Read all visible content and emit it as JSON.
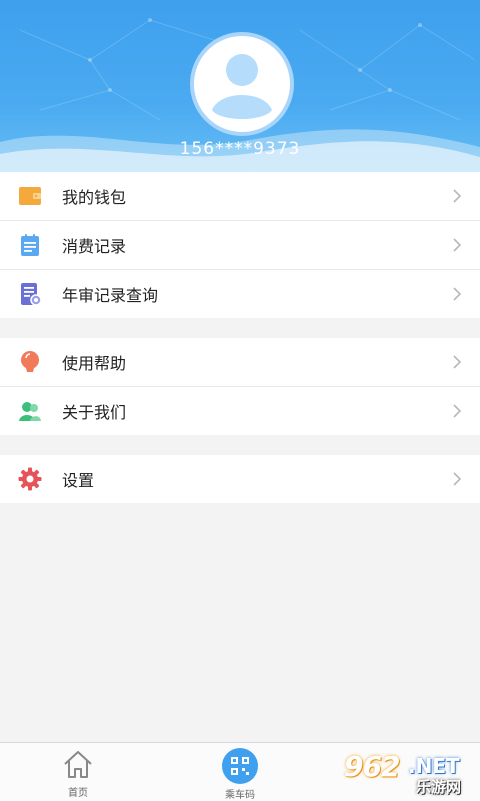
{
  "profile": {
    "phone": "156****9373"
  },
  "menu": {
    "group1": [
      {
        "label": "我的钱包",
        "icon": "wallet-icon"
      },
      {
        "label": "消费记录",
        "icon": "notepad-icon"
      },
      {
        "label": "年审记录查询",
        "icon": "document-search-icon"
      }
    ],
    "group2": [
      {
        "label": "使用帮助",
        "icon": "lightbulb-icon"
      },
      {
        "label": "关于我们",
        "icon": "users-icon"
      }
    ],
    "group3": [
      {
        "label": "设置",
        "icon": "gear-icon"
      }
    ]
  },
  "bottom_nav": {
    "home_label": "首页",
    "ride_code_label": "乘车码"
  },
  "watermark": {
    "logo": "962",
    "net": ".NET",
    "sub": "乐游网"
  },
  "colors": {
    "header_blue": "#3ea0ee",
    "wallet": "#f3a93c",
    "notepad": "#5aa9f0",
    "document": "#6b6fd8",
    "lightbulb": "#f07a5a",
    "users": "#3cbf7a",
    "gear": "#e6545a"
  }
}
